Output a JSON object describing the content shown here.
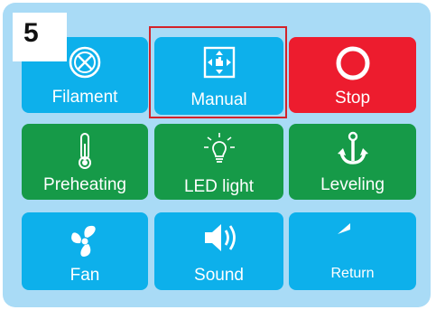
{
  "step_number": "5",
  "tiles": [
    {
      "label": "Filament",
      "icon": "filament-reel-icon",
      "color": "#0db0eb"
    },
    {
      "label": "Manual",
      "icon": "manual-move-icon",
      "color": "#0db0eb",
      "selected": true
    },
    {
      "label": "Stop",
      "icon": "stop-ring-icon",
      "color": "#ed1c2e"
    },
    {
      "label": "Preheating",
      "icon": "thermometer-icon",
      "color": "#169a48"
    },
    {
      "label": "LED light",
      "icon": "light-bulb-icon",
      "color": "#169a48"
    },
    {
      "label": "Leveling",
      "icon": "anchor-icon",
      "color": "#169a48"
    },
    {
      "label": "Fan",
      "icon": "fan-icon",
      "color": "#0db0eb"
    },
    {
      "label": "Sound",
      "icon": "speaker-icon",
      "color": "#0db0eb"
    },
    {
      "label": "Return",
      "icon": "return-arrow-icon",
      "color": "#0db0eb"
    }
  ],
  "highlight_color": "#d3222a"
}
